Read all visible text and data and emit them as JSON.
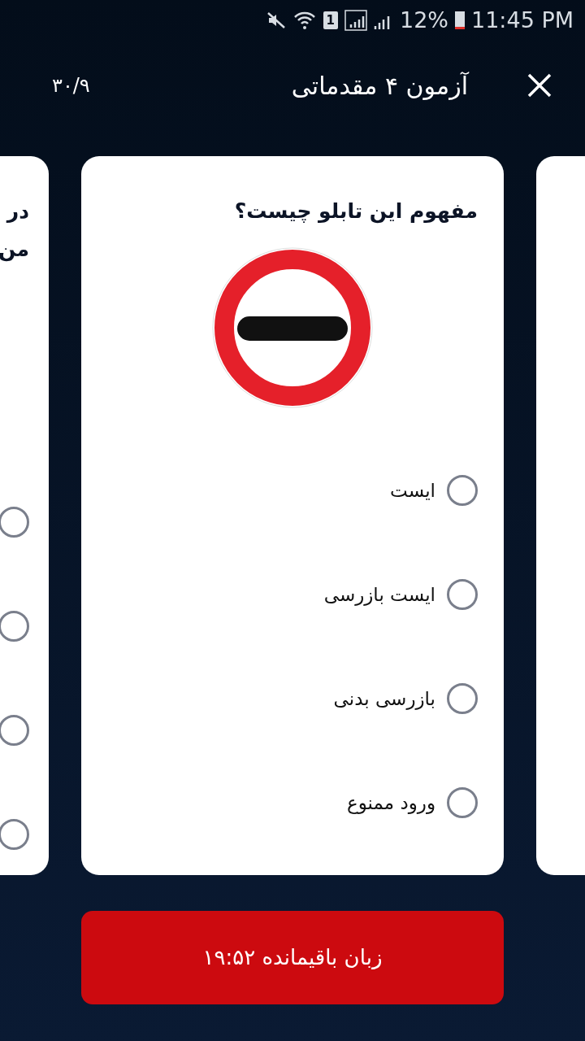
{
  "status_bar": {
    "sim": "1",
    "battery": "12%",
    "time": "11:45 PM"
  },
  "header": {
    "title": "آزمون ۴ مقدماتی",
    "progress": "۳۰/۹"
  },
  "previous_card": {
    "question_lines": [
      "در",
      "من"
    ],
    "options": [
      {
        "selected": false
      },
      {
        "selected": false
      },
      {
        "selected": false
      },
      {
        "selected": false
      }
    ]
  },
  "current_card": {
    "question": "مفهوم این تابلو چیست؟",
    "options": [
      {
        "label": "ایست",
        "selected": false
      },
      {
        "label": "ایست بازرسی",
        "selected": false
      },
      {
        "label": "بازرسی بدنی",
        "selected": false
      },
      {
        "label": "ورود ممنوع",
        "selected": false
      }
    ]
  },
  "timer_button": {
    "label": "زبان باقیمانده ۱۹:۵۲"
  }
}
